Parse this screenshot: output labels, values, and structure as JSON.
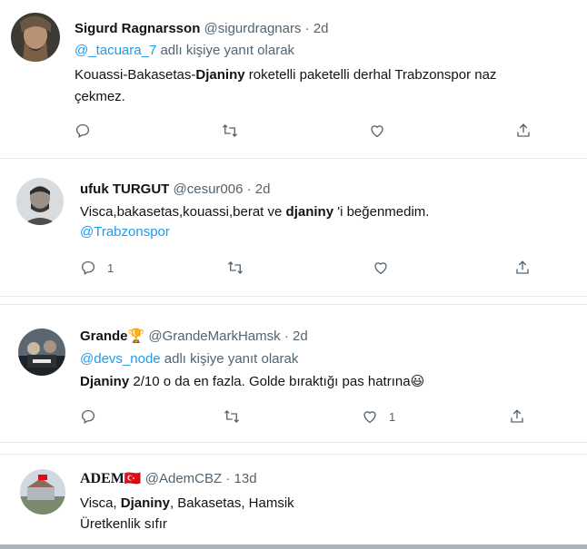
{
  "tweets": [
    {
      "display_name": "Sigurd Ragnarsson",
      "handle": "@sigurdragnars",
      "sep": "·",
      "time": "2d",
      "reply_handle": "@_tacuara_7",
      "reply_suffix": " adlı kişiye yanıt olarak",
      "l1_a": "Kouassi-Bakasetas-",
      "l1_b": "Djaniny",
      "l1_c": " roketelli paketelli derhal Trabzonspor naz",
      "l2": "çekmez.",
      "reply_count": "",
      "like_count": ""
    },
    {
      "display_name": "ufuk TURGUT",
      "handle": "@cesur006",
      "sep": "·",
      "time": "2d",
      "l1_a": "Visca,bakasetas,kouassi,berat ve ",
      "l1_b": "djaniny",
      "l1_c": " 'i  beğenmedim.",
      "mention": "@Trabzonspor",
      "reply_count": "1",
      "like_count": ""
    },
    {
      "display_name": "Grande",
      "trophy": "🏆",
      "handle": "@GrandeMarkHamsk",
      "sep": "·",
      "time": "2d",
      "reply_handle": "@devs_node",
      "reply_suffix": " adlı kişiye yanıt olarak",
      "l1_a": "Djaniny",
      "l1_b": " 2/10 o da en fazla. Golde bıraktığı pas hatrına",
      "emoji": "😃",
      "reply_count": "",
      "like_count": "1"
    },
    {
      "display_name": "ADEM",
      "flag": "🇹🇷",
      "handle": "@AdemCBZ",
      "sep": "·",
      "time": "13d",
      "l1_a": "Visca, ",
      "l1_b": "Djaniny",
      "l1_c": ", Bakasetas, Hamsik",
      "l2": "Üretkenlik sıfır"
    }
  ],
  "colors": {
    "accent": "#1d9bf0",
    "secondary": "#536471",
    "text": "#0f1419",
    "divider": "#e6e8ea"
  },
  "icons": [
    "reply-icon",
    "retweet-icon",
    "like-icon",
    "share-icon"
  ]
}
